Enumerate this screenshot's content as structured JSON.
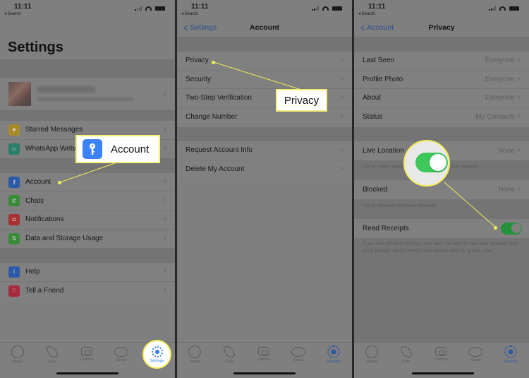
{
  "status_bar": {
    "time": "11:11",
    "back_label": "◂ Search"
  },
  "panel1": {
    "title": "Settings",
    "group1": [
      {
        "label": "Starred Messages",
        "icon": "star-icon",
        "color": "#a88a2a"
      },
      {
        "label": "WhatsApp Web/Desktop",
        "icon": "laptop-icon",
        "color": "#2d7d6b"
      }
    ],
    "group2": [
      {
        "label": "Account",
        "icon": "key-icon",
        "color": "#2a5aa8"
      },
      {
        "label": "Chats",
        "icon": "whatsapp-icon",
        "color": "#3a8a3a"
      },
      {
        "label": "Notifications",
        "icon": "notification-icon",
        "color": "#a8302e"
      },
      {
        "label": "Data and Storage Usage",
        "icon": "data-arrows-icon",
        "color": "#3a8a3a"
      }
    ],
    "group3": [
      {
        "label": "Help",
        "icon": "info-icon",
        "color": "#2a5aa8"
      },
      {
        "label": "Tell a Friend",
        "icon": "heart-icon",
        "color": "#a82a3a"
      }
    ],
    "callout": "Account"
  },
  "panel2": {
    "back": "Settings",
    "title": "Account",
    "group1": [
      {
        "label": "Privacy"
      },
      {
        "label": "Security"
      },
      {
        "label": "Two-Step Verification"
      },
      {
        "label": "Change Number"
      }
    ],
    "group2": [
      {
        "label": "Request Account Info"
      },
      {
        "label": "Delete My Account"
      }
    ],
    "callout": "Privacy"
  },
  "panel3": {
    "back": "Account",
    "title": "Privacy",
    "group1": [
      {
        "label": "Last Seen",
        "value": "Everyone"
      },
      {
        "label": "Profile Photo",
        "value": "Everyone"
      },
      {
        "label": "About",
        "value": "Everyone"
      },
      {
        "label": "Status",
        "value": "My Contacts"
      }
    ],
    "live_location": {
      "label": "Live Location",
      "value": "None",
      "note": "List of chats where you are sharing your live location."
    },
    "blocked": {
      "label": "Blocked",
      "value": "None",
      "note": "List of contacts you have blocked."
    },
    "read_receipts": {
      "label": "Read Receipts",
      "enabled": true,
      "note": "If you turn off read receipts, you won't be able to see read receipts from other people. Read receipts are always sent for group chats."
    }
  },
  "tabbar": {
    "tabs": [
      {
        "label": "Status",
        "icon": "status-icon"
      },
      {
        "label": "Calls",
        "icon": "calls-icon"
      },
      {
        "label": "Camera",
        "icon": "camera-icon"
      },
      {
        "label": "Chats",
        "icon": "chats-icon"
      },
      {
        "label": "Settings",
        "icon": "settings-icon",
        "active": true
      }
    ]
  },
  "colors": {
    "accent": "#3b82f6",
    "toggle_on": "#3fc85a",
    "highlight": "#f4ec5a"
  }
}
